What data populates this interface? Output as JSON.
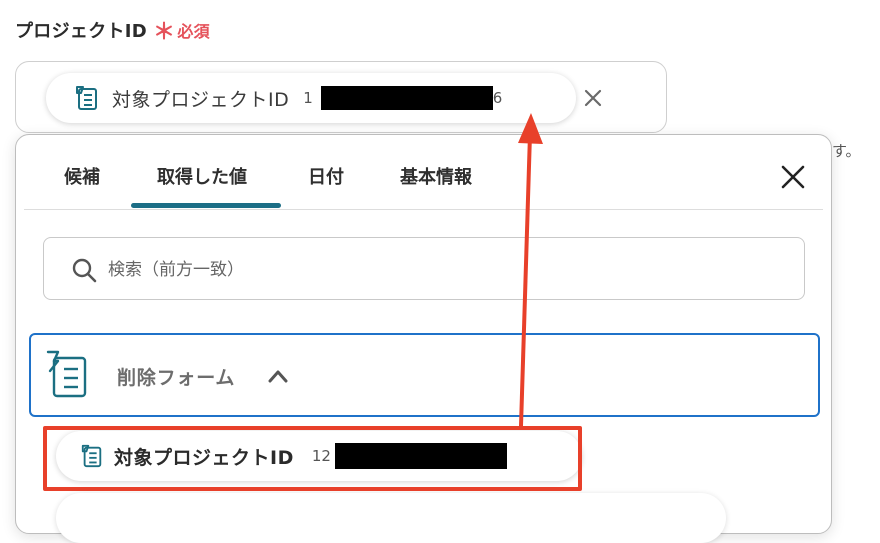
{
  "field": {
    "label": "プロジェクトID",
    "required_mark": "＊",
    "required_text": "必須",
    "chip": {
      "label": "対象プロジェクトID",
      "value_prefix": "1",
      "value_suffix": "6",
      "icon": "form-doc-icon"
    },
    "clipped_text": "す。"
  },
  "picker": {
    "tabs": [
      {
        "label": "候補"
      },
      {
        "label": "取得した値",
        "active": true
      },
      {
        "label": "日付"
      },
      {
        "label": "基本情報"
      }
    ],
    "search": {
      "placeholder": "検索（前方一致）"
    },
    "group": {
      "title": "削除フォーム",
      "expanded": true,
      "icon": "form-trigger-icon"
    },
    "items": [
      {
        "label": "対象プロジェクトID",
        "value_prefix": "12",
        "icon": "form-doc-icon"
      }
    ]
  },
  "colors": {
    "required": "#e5525b",
    "tab_underline": "#1c6e86",
    "group_border": "#1f72c9",
    "annotation": "#e8402a",
    "icon_teal": "#1b6f82"
  }
}
